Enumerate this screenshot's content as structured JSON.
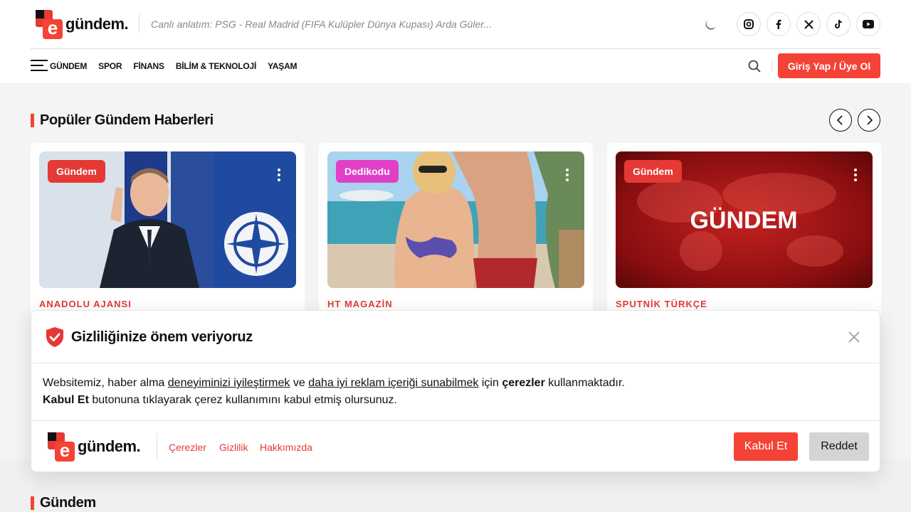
{
  "header": {
    "logo_letter": "e",
    "logo_text": "gündem.",
    "ticker": "Canlı anlatım: PSG - Real Madrid (FIFA Kulüpler Dünya Kupası) Arda Güler...",
    "social_icons": [
      "instagram-icon",
      "facebook-icon",
      "x-icon",
      "tiktok-icon",
      "youtube-icon"
    ],
    "login_label": "Giriş Yap / Üye Ol"
  },
  "nav": {
    "items": [
      "GÜNDEM",
      "SPOR",
      "FİNANS",
      "BİLİM & TEKNOLOJİ",
      "YAŞAM"
    ]
  },
  "popular": {
    "title": "Popüler Gündem Haberleri",
    "cards": [
      {
        "badge": "Gündem",
        "badge_color": "#e53935",
        "source": "ANADOLU AJANSI"
      },
      {
        "badge": "Dedikodu",
        "badge_color": "#e040c8",
        "source": "HT MAGAZİN"
      },
      {
        "badge": "Gündem",
        "badge_color": "#e53935",
        "source": "SPUTNİK TÜRKÇE",
        "image_text": "GÜNDEM"
      }
    ]
  },
  "cookie": {
    "title": "Gizliliğinize önem veriyoruz",
    "line1_a": "Websitemiz, haber alma ",
    "line1_link1": "deneyiminizi iyileştirmek",
    "line1_b": " ve ",
    "line1_link2": "daha iyi reklam içeriği sunabilmek",
    "line1_c": " için ",
    "line1_bold": "çerezler",
    "line1_d": " kullanmaktadır.",
    "line2_bold": "Kabul Et",
    "line2_rest": " butonuna tıklayarak çerez kullanımını kabul etmiş olursunuz.",
    "links": [
      "Çerezler",
      "Gizlilik",
      "Hakkımızda"
    ],
    "accept_label": "Kabul Et",
    "reject_label": "Reddet"
  },
  "next_section": {
    "title": "Gündem"
  },
  "colors": {
    "accent": "#f44336",
    "accent_dark": "#e53935",
    "dedikodu": "#e040c8"
  }
}
